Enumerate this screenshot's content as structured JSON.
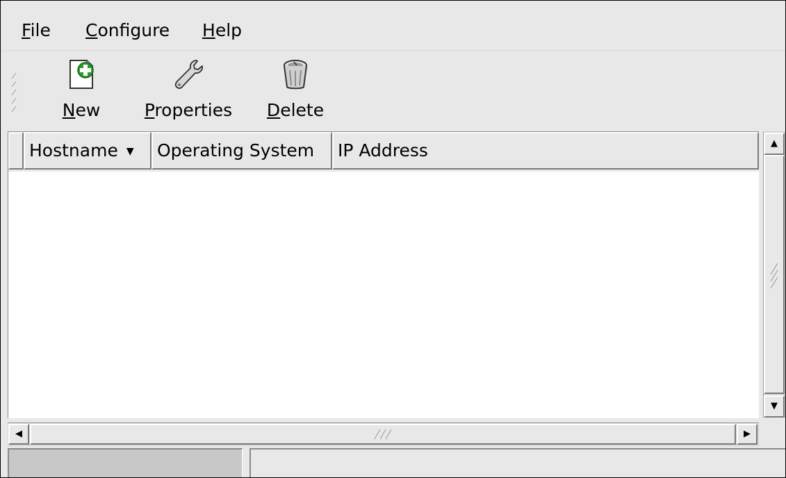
{
  "menubar": {
    "items": [
      {
        "mnemonic": "F",
        "rest": "ile"
      },
      {
        "mnemonic": "C",
        "rest": "onfigure"
      },
      {
        "mnemonic": "H",
        "rest": "elp"
      }
    ]
  },
  "toolbar": {
    "buttons": [
      {
        "mnemonic": "N",
        "rest": "ew",
        "icon": "new-document-plus-icon"
      },
      {
        "mnemonic": "P",
        "rest": "roperties",
        "icon": "wrench-icon"
      },
      {
        "mnemonic": "D",
        "rest": "elete",
        "icon": "trash-can-icon"
      }
    ]
  },
  "list": {
    "columns": [
      "Hostname",
      "Operating System",
      "IP Address"
    ],
    "sort_column": "Hostname",
    "sort_direction": "descending",
    "rows": []
  },
  "statusbar": {
    "text": ""
  }
}
